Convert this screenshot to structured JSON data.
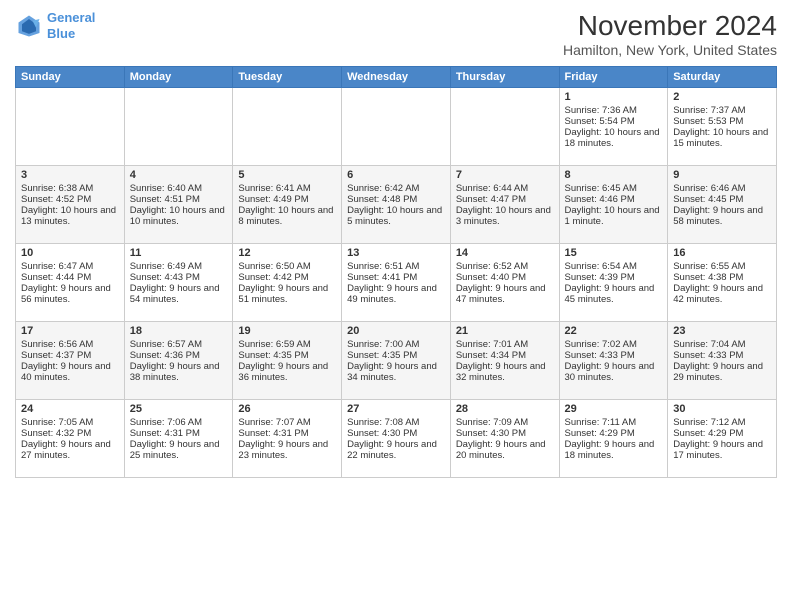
{
  "header": {
    "logo_line1": "General",
    "logo_line2": "Blue",
    "title": "November 2024",
    "subtitle": "Hamilton, New York, United States"
  },
  "days_of_week": [
    "Sunday",
    "Monday",
    "Tuesday",
    "Wednesday",
    "Thursday",
    "Friday",
    "Saturday"
  ],
  "weeks": [
    [
      {
        "day": "",
        "data": ""
      },
      {
        "day": "",
        "data": ""
      },
      {
        "day": "",
        "data": ""
      },
      {
        "day": "",
        "data": ""
      },
      {
        "day": "",
        "data": ""
      },
      {
        "day": "1",
        "data": "Sunrise: 7:36 AM\nSunset: 5:54 PM\nDaylight: 10 hours and 18 minutes."
      },
      {
        "day": "2",
        "data": "Sunrise: 7:37 AM\nSunset: 5:53 PM\nDaylight: 10 hours and 15 minutes."
      }
    ],
    [
      {
        "day": "3",
        "data": "Sunrise: 6:38 AM\nSunset: 4:52 PM\nDaylight: 10 hours and 13 minutes."
      },
      {
        "day": "4",
        "data": "Sunrise: 6:40 AM\nSunset: 4:51 PM\nDaylight: 10 hours and 10 minutes."
      },
      {
        "day": "5",
        "data": "Sunrise: 6:41 AM\nSunset: 4:49 PM\nDaylight: 10 hours and 8 minutes."
      },
      {
        "day": "6",
        "data": "Sunrise: 6:42 AM\nSunset: 4:48 PM\nDaylight: 10 hours and 5 minutes."
      },
      {
        "day": "7",
        "data": "Sunrise: 6:44 AM\nSunset: 4:47 PM\nDaylight: 10 hours and 3 minutes."
      },
      {
        "day": "8",
        "data": "Sunrise: 6:45 AM\nSunset: 4:46 PM\nDaylight: 10 hours and 1 minute."
      },
      {
        "day": "9",
        "data": "Sunrise: 6:46 AM\nSunset: 4:45 PM\nDaylight: 9 hours and 58 minutes."
      }
    ],
    [
      {
        "day": "10",
        "data": "Sunrise: 6:47 AM\nSunset: 4:44 PM\nDaylight: 9 hours and 56 minutes."
      },
      {
        "day": "11",
        "data": "Sunrise: 6:49 AM\nSunset: 4:43 PM\nDaylight: 9 hours and 54 minutes."
      },
      {
        "day": "12",
        "data": "Sunrise: 6:50 AM\nSunset: 4:42 PM\nDaylight: 9 hours and 51 minutes."
      },
      {
        "day": "13",
        "data": "Sunrise: 6:51 AM\nSunset: 4:41 PM\nDaylight: 9 hours and 49 minutes."
      },
      {
        "day": "14",
        "data": "Sunrise: 6:52 AM\nSunset: 4:40 PM\nDaylight: 9 hours and 47 minutes."
      },
      {
        "day": "15",
        "data": "Sunrise: 6:54 AM\nSunset: 4:39 PM\nDaylight: 9 hours and 45 minutes."
      },
      {
        "day": "16",
        "data": "Sunrise: 6:55 AM\nSunset: 4:38 PM\nDaylight: 9 hours and 42 minutes."
      }
    ],
    [
      {
        "day": "17",
        "data": "Sunrise: 6:56 AM\nSunset: 4:37 PM\nDaylight: 9 hours and 40 minutes."
      },
      {
        "day": "18",
        "data": "Sunrise: 6:57 AM\nSunset: 4:36 PM\nDaylight: 9 hours and 38 minutes."
      },
      {
        "day": "19",
        "data": "Sunrise: 6:59 AM\nSunset: 4:35 PM\nDaylight: 9 hours and 36 minutes."
      },
      {
        "day": "20",
        "data": "Sunrise: 7:00 AM\nSunset: 4:35 PM\nDaylight: 9 hours and 34 minutes."
      },
      {
        "day": "21",
        "data": "Sunrise: 7:01 AM\nSunset: 4:34 PM\nDaylight: 9 hours and 32 minutes."
      },
      {
        "day": "22",
        "data": "Sunrise: 7:02 AM\nSunset: 4:33 PM\nDaylight: 9 hours and 30 minutes."
      },
      {
        "day": "23",
        "data": "Sunrise: 7:04 AM\nSunset: 4:33 PM\nDaylight: 9 hours and 29 minutes."
      }
    ],
    [
      {
        "day": "24",
        "data": "Sunrise: 7:05 AM\nSunset: 4:32 PM\nDaylight: 9 hours and 27 minutes."
      },
      {
        "day": "25",
        "data": "Sunrise: 7:06 AM\nSunset: 4:31 PM\nDaylight: 9 hours and 25 minutes."
      },
      {
        "day": "26",
        "data": "Sunrise: 7:07 AM\nSunset: 4:31 PM\nDaylight: 9 hours and 23 minutes."
      },
      {
        "day": "27",
        "data": "Sunrise: 7:08 AM\nSunset: 4:30 PM\nDaylight: 9 hours and 22 minutes."
      },
      {
        "day": "28",
        "data": "Sunrise: 7:09 AM\nSunset: 4:30 PM\nDaylight: 9 hours and 20 minutes."
      },
      {
        "day": "29",
        "data": "Sunrise: 7:11 AM\nSunset: 4:29 PM\nDaylight: 9 hours and 18 minutes."
      },
      {
        "day": "30",
        "data": "Sunrise: 7:12 AM\nSunset: 4:29 PM\nDaylight: 9 hours and 17 minutes."
      }
    ]
  ]
}
